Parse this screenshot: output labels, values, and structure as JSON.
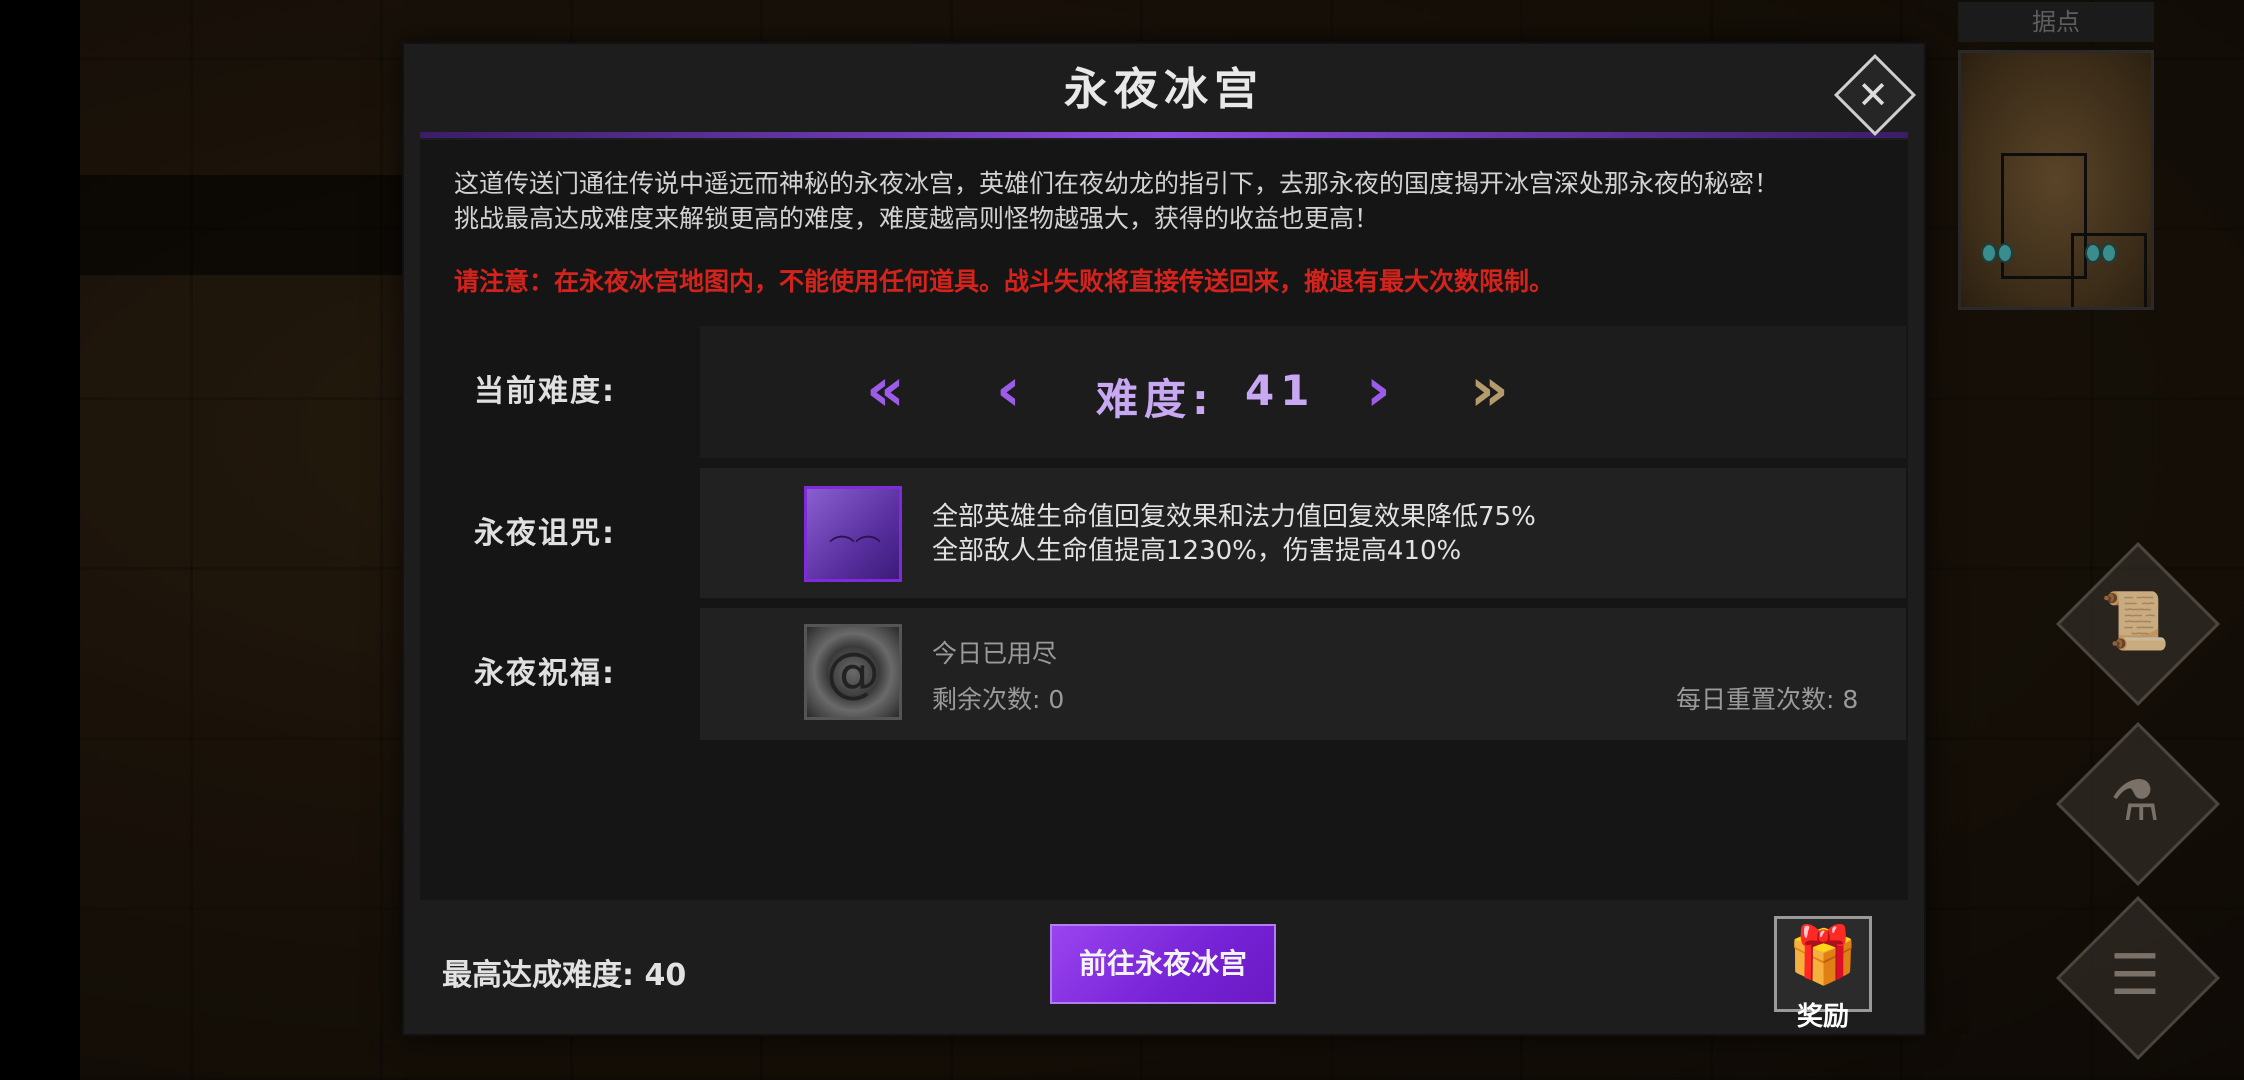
{
  "minimap": {
    "title": "据点"
  },
  "side_buttons": [
    {
      "icon": "scroll-icon",
      "glyph": "📜"
    },
    {
      "icon": "potion-icon",
      "glyph": "⚗"
    },
    {
      "icon": "menu-list-icon",
      "glyph": "☰"
    }
  ],
  "dialog": {
    "title": "永夜冰宫",
    "close_glyph": "✕",
    "description_line1": "这道传送门通往传说中遥远而神秘的永夜冰宫，英雄们在夜幼龙的指引下，去那永夜的国度揭开冰宫深处那永夜的秘密！",
    "description_line2": "挑战最高达成难度来解锁更高的难度，难度越高则怪物越强大，获得的收益也更高！",
    "warning": "请注意：在永夜冰宫地图内，不能使用任何道具。战斗失败将直接传送回来，撤退有最大次数限制。",
    "difficulty": {
      "label": "当前难度:",
      "value_label": "难度:",
      "value": "41",
      "first_glyph": "«",
      "prev_glyph": "‹",
      "next_glyph": "›",
      "last_glyph": "»"
    },
    "curse": {
      "label": "永夜诅咒:",
      "line1": "全部英雄生命值回复效果和法力值回复效果降低75%",
      "line2": "全部敌人生命值提高1230%，伤害提高410%",
      "icon": "bats-icon"
    },
    "blessing": {
      "label": "永夜祝福:",
      "status": "今日已用尽",
      "remaining": "剩余次数: 0",
      "daily_reset": "每日重置次数: 8",
      "icon": "swirl-icon"
    },
    "best_difficulty": "最高达成难度: 40",
    "go_button": "前往永夜冰宫",
    "reward_label": "奖励",
    "colors": {
      "accent": "#8a4be0",
      "warning": "#d4231c",
      "difficulty_text": "#c8a8f2"
    }
  }
}
